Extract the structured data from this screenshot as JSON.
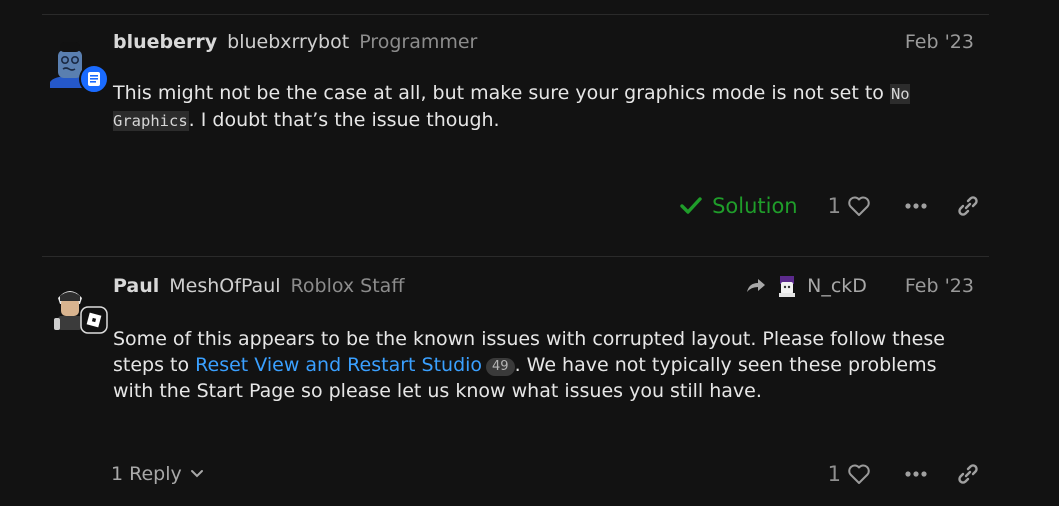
{
  "posts": [
    {
      "username": "blueberry",
      "fullname": "bluebxrrybot",
      "user_title": "Programmer",
      "date": "Feb '23",
      "body_text_1": "This might not be the case at all, but make sure your graphics mode is not set to ",
      "body_code": "No Graphics",
      "body_text_2": ". I doubt that’s the issue though.",
      "solution_label": "Solution",
      "like_count": "1",
      "icons": [
        "avatar-blueberry",
        "badge-scroll-icon",
        "check-icon",
        "heart-icon",
        "ellipsis-icon",
        "link-icon"
      ],
      "colors": {
        "solution": "#1f9d2a",
        "badge": "#1a6bff"
      }
    },
    {
      "username": "Paul",
      "fullname": "MeshOfPaul",
      "user_title": "Roblox Staff",
      "reply_to_name": "N_ckD",
      "date": "Feb '23",
      "body_text_1": "Some of this appears to be the known issues with corrupted layout. Please follow these steps to ",
      "body_link": "Reset View and Restart Studio",
      "link_clicks": "49",
      "body_text_2": ". We have not typically seen these problems with the Start Page so please let us know what issues you still have.",
      "replies_label": "1 Reply",
      "like_count": "1",
      "icons": [
        "avatar-paul",
        "roblox-badge-icon",
        "reply-arrow-icon",
        "heart-icon",
        "ellipsis-icon",
        "link-icon",
        "chevron-down-icon"
      ],
      "colors": {
        "link": "#3aa0ff"
      }
    }
  ]
}
